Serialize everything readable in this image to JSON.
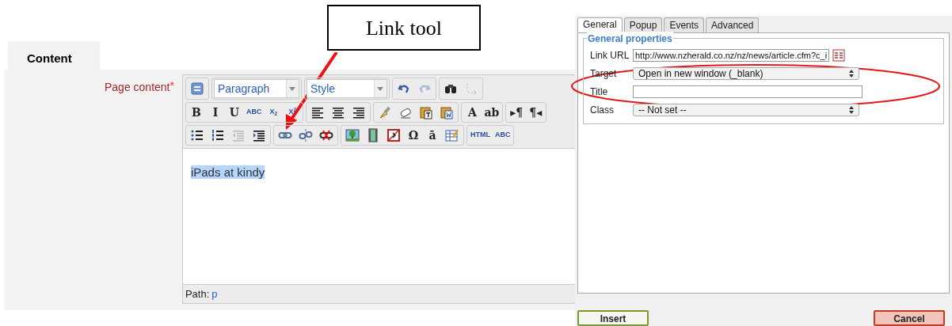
{
  "section_tab": {
    "label": "Content"
  },
  "field_label": {
    "text": "Page content",
    "required_mark": "*"
  },
  "editor": {
    "format_select": "Paragraph",
    "style_select": "Style",
    "toolbar_rows": [
      [
        [
          {
            "kind": "icon"
          }
        ],
        [
          {
            "kind": "select_format"
          }
        ],
        [
          {
            "kind": "select_style"
          }
        ],
        [
          {
            "kind": "icon"
          },
          {
            "kind": "icon",
            "disabled": true
          }
        ],
        [
          {
            "kind": "icon"
          },
          {
            "kind": "icon",
            "disabled": true
          }
        ]
      ],
      [
        [
          {
            "kind": "text",
            "label": "B"
          },
          {
            "kind": "text",
            "label": "I"
          },
          {
            "kind": "text",
            "label": "U"
          },
          {
            "kind": "text",
            "label": "ABC"
          },
          {
            "kind": "text",
            "label": "X$_{2}$"
          },
          {
            "kind": "text",
            "label": "X$^{2}$"
          }
        ],
        [
          {
            "kind": "icon"
          },
          {
            "kind": "icon"
          },
          {
            "kind": "icon"
          }
        ],
        [
          {
            "kind": "icon"
          },
          {
            "kind": "icon"
          },
          {
            "kind": "icon"
          },
          {
            "kind": "icon"
          }
        ],
        [
          {
            "kind": "text",
            "label": "A"
          },
          {
            "kind": "text",
            "label": "ab"
          }
        ],
        [
          {
            "kind": "text",
            "label": "▸¶"
          },
          {
            "kind": "text",
            "label": "¶◂"
          }
        ]
      ],
      [
        [
          {
            "kind": "icon"
          },
          {
            "kind": "icon"
          },
          {
            "kind": "icon",
            "disabled": true
          },
          {
            "kind": "icon"
          }
        ],
        [
          {
            "kind": "icon"
          },
          {
            "kind": "icon"
          },
          {
            "kind": "icon"
          }
        ],
        [
          {
            "kind": "icon"
          },
          {
            "kind": "icon"
          },
          {
            "kind": "icon"
          },
          {
            "kind": "text",
            "label": "Ω"
          },
          {
            "kind": "text",
            "label": "ā"
          },
          {
            "kind": "icon"
          }
        ],
        [
          {
            "kind": "text",
            "label": "HTML"
          },
          {
            "kind": "text",
            "label": "ABC"
          }
        ]
      ]
    ],
    "content": "iPads at kindy",
    "path_label": "Path:",
    "path_value": "p"
  },
  "callout": {
    "text": "Link tool"
  },
  "dialog": {
    "tabs": [
      {
        "label": "General",
        "selected": true
      },
      {
        "label": "Popup",
        "selected": false
      },
      {
        "label": "Events",
        "selected": false
      },
      {
        "label": "Advanced",
        "selected": false
      }
    ],
    "legend": "General properties",
    "fields": [
      {
        "kind": "input",
        "label": "Link URL",
        "value": "http://www.nzherald.co.nz/nz/news/article.cfm?c_i"
      },
      {
        "kind": "select",
        "label": "Target",
        "value": "Open in new window (_blank)"
      },
      {
        "kind": "input",
        "label": "Title"
      },
      {
        "kind": "select",
        "label": "Class",
        "value": "-- Not set --"
      }
    ],
    "buttons": [
      {
        "label": "Insert",
        "kind": "primary"
      },
      {
        "label": "Cancel",
        "kind": "cancel"
      }
    ]
  }
}
